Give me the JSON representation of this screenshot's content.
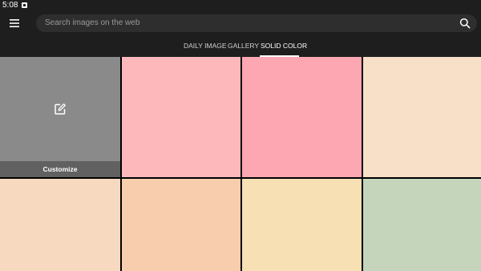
{
  "status_bar": {
    "time": "5:08",
    "notification_icon": "notification-a-icon"
  },
  "app_bar": {
    "menu_icon": "hamburger-menu-icon",
    "search_placeholder": "Search images on the web",
    "search_icon": "search-icon"
  },
  "tabs": [
    {
      "label": "DAILY IMAGE",
      "active": false
    },
    {
      "label": "GALLERY",
      "active": false
    },
    {
      "label": "SOLID COLOR",
      "active": true
    }
  ],
  "colors": {
    "background": "#1e1e1e",
    "search_field": "#2e2e2e",
    "customize_tile": "#8a8a8a",
    "customize_bar": "#616161"
  },
  "grid": {
    "customize": {
      "label": "Customize",
      "icon": "edit-icon"
    },
    "swatches": [
      "#fdb8bc",
      "#fda7b3",
      "#f8dfc7",
      "#f7d9c0",
      "#f8cdad",
      "#f6e0b4",
      "#c4d5bc"
    ]
  }
}
